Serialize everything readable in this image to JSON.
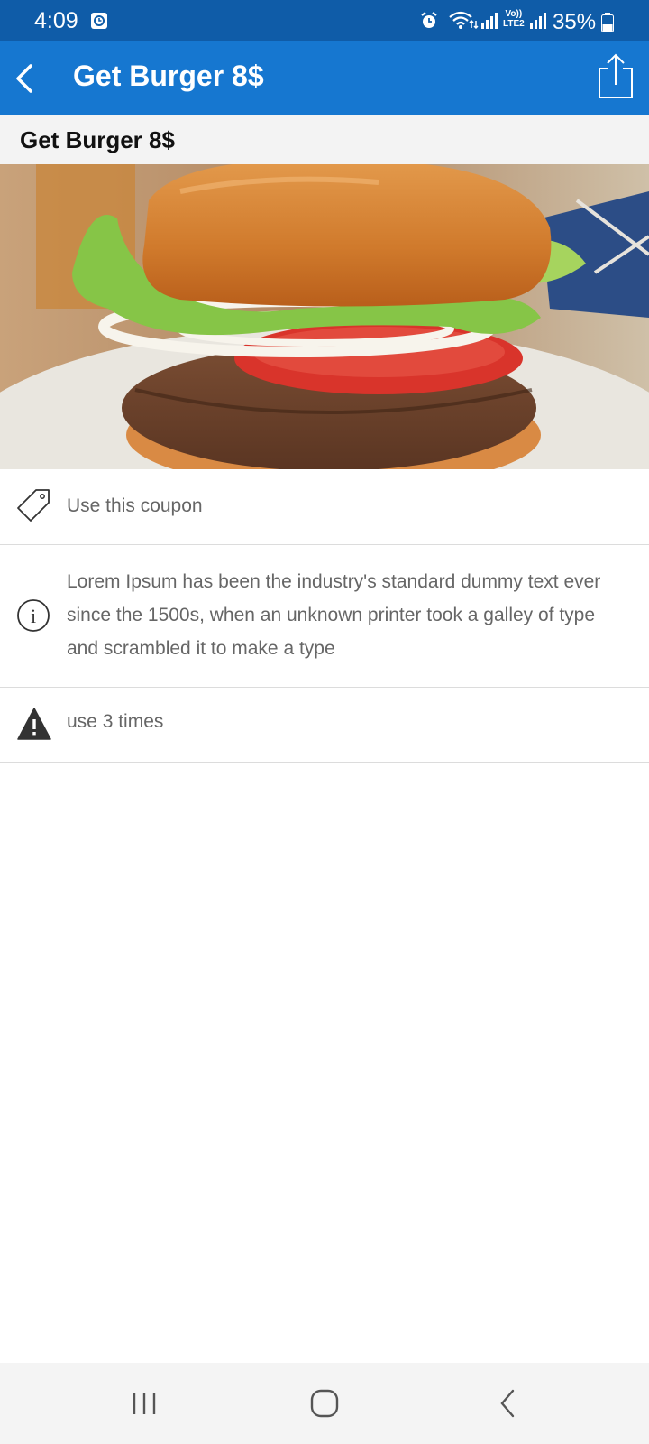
{
  "status_bar": {
    "time": "4:09",
    "volte_line1": "Vo))",
    "volte_line2": "LTE2",
    "battery": "35%"
  },
  "app_bar": {
    "title": "Get Burger 8$"
  },
  "sub_header": {
    "title": "Get Burger 8$"
  },
  "details": [
    {
      "icon": "tag-icon",
      "text": "Use this coupon"
    },
    {
      "icon": "info-icon",
      "text": "Lorem Ipsum has been the industry's standard dummy text ever since the 1500s, when an unknown printer took a galley of type and scrambled it to make a type"
    },
    {
      "icon": "warning-icon",
      "text": "use 3 times"
    }
  ],
  "colors": {
    "status_bar": "#0f5ca8",
    "app_bar": "#1677d0",
    "sub_header_bg": "#f3f3f3",
    "body_text": "#666666",
    "divider": "#dcdcdc"
  }
}
